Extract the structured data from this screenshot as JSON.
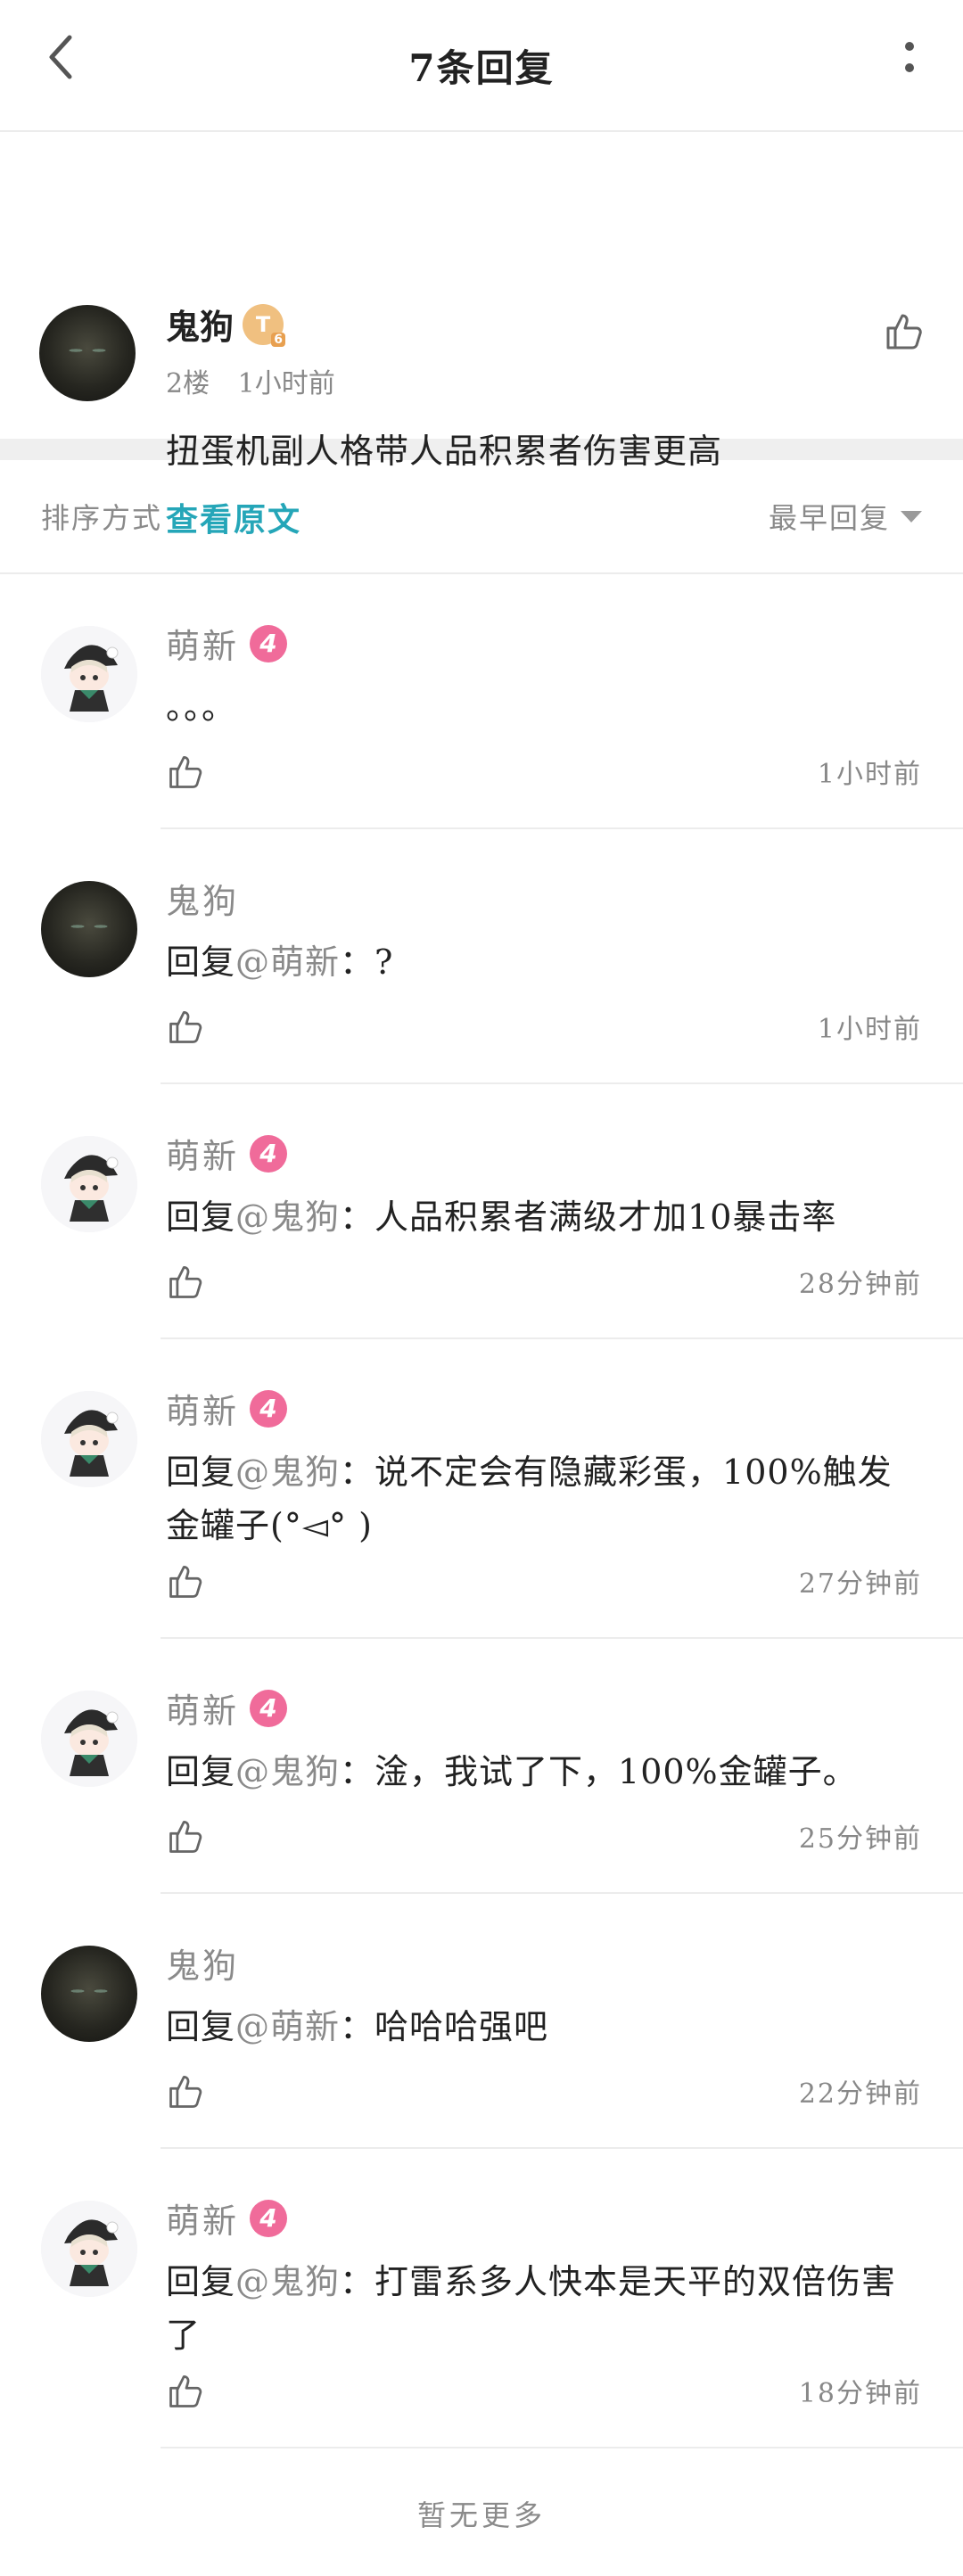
{
  "header": {
    "title": "7条回复",
    "back_icon": "back-arrow-icon",
    "more_icon": "more-vertical-icon"
  },
  "original_post": {
    "author": "鬼狗",
    "badge_letter": "T",
    "badge_sub": "6",
    "floor": "2楼",
    "time": "1小时前",
    "text": "扭蛋机副人格带人品积累者伤害更高",
    "view_original": "查看原文"
  },
  "sort": {
    "label": "排序方式",
    "value": "最早回复"
  },
  "replies": [
    {
      "author": "萌新",
      "level": "4",
      "avatar": "chibi",
      "prefix": "",
      "target": "",
      "text": "。。。",
      "time": "1小时前"
    },
    {
      "author": "鬼狗",
      "level": "",
      "avatar": "dark",
      "prefix": "回复",
      "target": "@萌新",
      "text": "：?",
      "time": "1小时前"
    },
    {
      "author": "萌新",
      "level": "4",
      "avatar": "chibi",
      "prefix": "回复",
      "target": "@鬼狗",
      "text": "：人品积累者满级才加10暴击率",
      "time": "28分钟前"
    },
    {
      "author": "萌新",
      "level": "4",
      "avatar": "chibi",
      "prefix": "回复",
      "target": "@鬼狗",
      "text": "：说不定会有隐藏彩蛋，100%触发金罐子(°◅° )",
      "time": "27分钟前"
    },
    {
      "author": "萌新",
      "level": "4",
      "avatar": "chibi",
      "prefix": "回复",
      "target": "@鬼狗",
      "text": "：淦，我试了下，100%金罐子。",
      "time": "25分钟前"
    },
    {
      "author": "鬼狗",
      "level": "",
      "avatar": "dark",
      "prefix": "回复",
      "target": "@萌新",
      "text": "：哈哈哈强吧",
      "time": "22分钟前"
    },
    {
      "author": "萌新",
      "level": "4",
      "avatar": "chibi",
      "prefix": "回复",
      "target": "@鬼狗",
      "text": "：打雷系多人快本是天平的双倍伤害了",
      "time": "18分钟前"
    }
  ],
  "footer": {
    "no_more": "暂无更多"
  },
  "colors": {
    "link": "#25a6b8",
    "level_badge": "#f06b9a",
    "muted": "#8a8a8a"
  }
}
